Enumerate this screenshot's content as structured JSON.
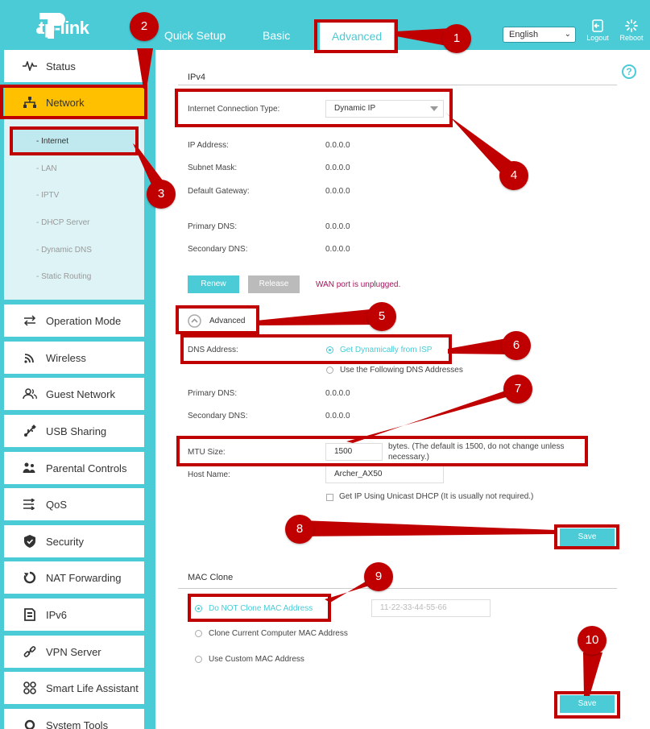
{
  "brand": {
    "logo_text": "tp-link"
  },
  "header": {
    "nav": {
      "quick_setup": "Quick Setup",
      "basic": "Basic",
      "advanced": "Advanced"
    },
    "language": "English",
    "logout_label": "Logout",
    "reboot_label": "Reboot"
  },
  "sidebar": {
    "items": [
      {
        "label": "Status",
        "icon": "pulse-icon"
      },
      {
        "label": "Network",
        "icon": "network-icon"
      },
      {
        "label": "Operation Mode",
        "icon": "switch-arrows-icon"
      },
      {
        "label": "Wireless",
        "icon": "wifi-icon"
      },
      {
        "label": "Guest Network",
        "icon": "guest-users-icon"
      },
      {
        "label": "USB Sharing",
        "icon": "usb-icon"
      },
      {
        "label": "Parental Controls",
        "icon": "family-icon"
      },
      {
        "label": "QoS",
        "icon": "qos-icon"
      },
      {
        "label": "Security",
        "icon": "shield-icon"
      },
      {
        "label": "NAT Forwarding",
        "icon": "nat-icon"
      },
      {
        "label": "IPv6",
        "icon": "ipv6-icon"
      },
      {
        "label": "VPN Server",
        "icon": "vpn-icon"
      },
      {
        "label": "Smart Life Assistant",
        "icon": "smart-life-icon"
      },
      {
        "label": "System Tools",
        "icon": "tools-icon"
      }
    ],
    "sub_items": [
      "- Internet",
      "- LAN",
      "- IPTV",
      "- DHCP Server",
      "- Dynamic DNS",
      "- Static Routing"
    ]
  },
  "ipv4": {
    "title": "IPv4",
    "connection_type_label": "Internet Connection Type:",
    "connection_type_value": "Dynamic IP",
    "ip_address_label": "IP Address:",
    "ip_address": "0.0.0.0",
    "subnet_mask_label": "Subnet Mask:",
    "subnet_mask": "0.0.0.0",
    "gateway_label": "Default Gateway:",
    "gateway": "0.0.0.0",
    "primary_dns_label": "Primary DNS:",
    "primary_dns": "0.0.0.0",
    "secondary_dns_label": "Secondary DNS:",
    "secondary_dns": "0.0.0.0",
    "renew_label": "Renew",
    "release_label": "Release",
    "warning": "WAN port is unplugged.",
    "advanced_label": "Advanced",
    "dns_address_label": "DNS Address:",
    "dns_option_auto": "Get Dynamically from ISP",
    "dns_option_manual": "Use the Following DNS Addresses",
    "adv_primary_dns_label": "Primary DNS:",
    "adv_primary_dns": "0.0.0.0",
    "adv_secondary_dns_label": "Secondary DNS:",
    "adv_secondary_dns": "0.0.0.0",
    "mtu_label": "MTU Size:",
    "mtu_value": "1500",
    "mtu_hint_1": "bytes. (The default is 1500, do not change unless",
    "mtu_hint_2": "necessary.)",
    "host_name_label": "Host Name:",
    "host_name_value": "Archer_AX50",
    "unicast_label": "Get IP Using Unicast DHCP (It is usually not required.)",
    "save_label": "Save"
  },
  "mac_clone": {
    "title": "MAC Clone",
    "option_none": "Do NOT Clone MAC Address",
    "option_current": "Clone Current Computer MAC Address",
    "option_custom": "Use Custom MAC Address",
    "mac_placeholder": "11-22-33-44-55-66",
    "save_label": "Save"
  },
  "annotations": [
    "1",
    "2",
    "3",
    "4",
    "5",
    "6",
    "7",
    "8",
    "9",
    "10"
  ],
  "colors": {
    "accent": "#4acbd6",
    "active_nav": "#ffc000",
    "annotation_red": "#c00000",
    "warning": "#a3135c"
  }
}
